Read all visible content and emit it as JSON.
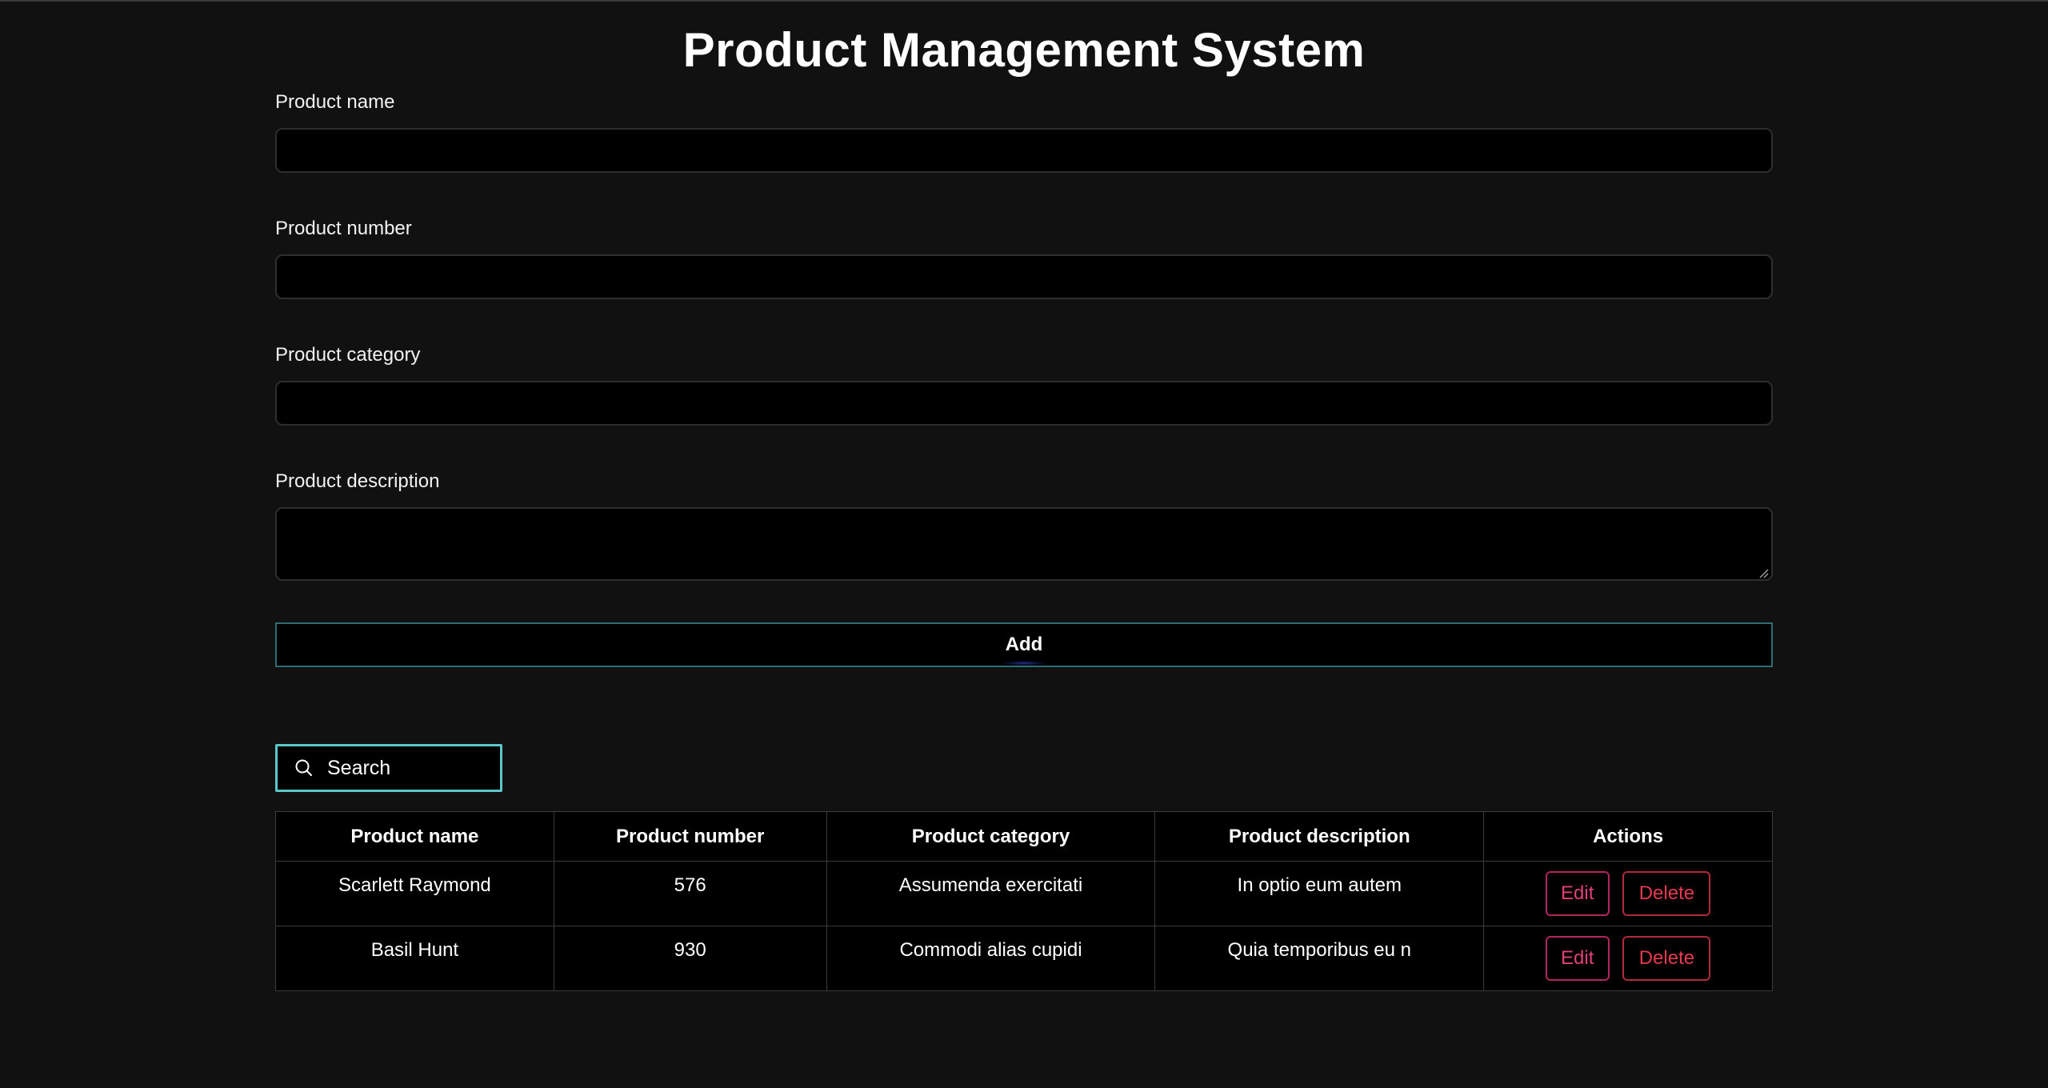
{
  "page": {
    "title": "Product Management System"
  },
  "form": {
    "name_label": "Product name",
    "name_value": "",
    "number_label": "Product number",
    "number_value": "",
    "category_label": "Product category",
    "category_value": "",
    "description_label": "Product description",
    "description_value": "",
    "add_label": "Add"
  },
  "search": {
    "placeholder": "Search",
    "value": "",
    "icon": "search-icon"
  },
  "table": {
    "headers": [
      "Product name",
      "Product number",
      "Product category",
      "Product description",
      "Actions"
    ],
    "rows": [
      {
        "name": "Scarlett Raymond",
        "number": "576",
        "category": "Assumenda exercitati",
        "description": "In optio eum autem",
        "edit": "Edit",
        "delete": "Delete"
      },
      {
        "name": "Basil Hunt",
        "number": "930",
        "category": "Commodi alias cupidi",
        "description": "Quia temporibus eu n",
        "edit": "Edit",
        "delete": "Delete"
      }
    ]
  },
  "colors": {
    "background": "#111111",
    "input_background": "#000000",
    "accent_border": "#5ac8c8",
    "edit_color": "#e0407a",
    "delete_color": "#e6394f"
  }
}
